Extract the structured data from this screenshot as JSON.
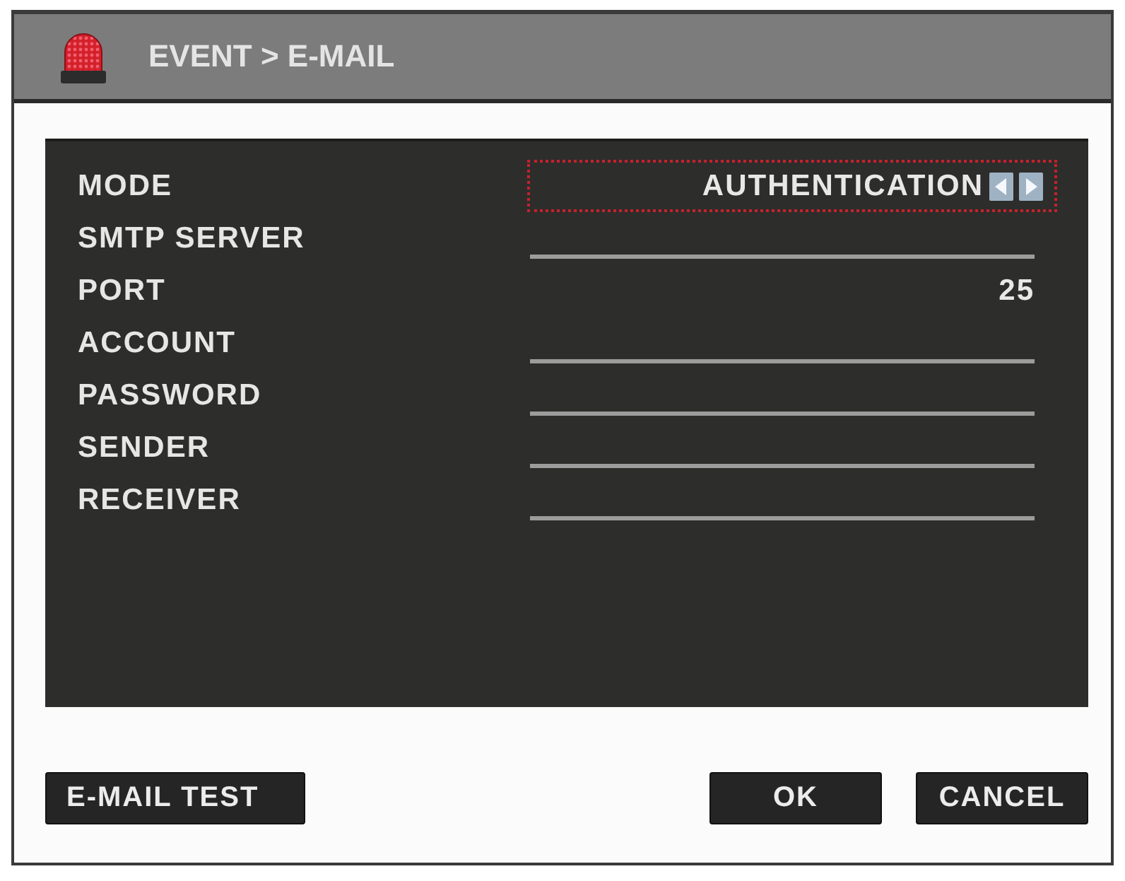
{
  "window": {
    "title": "EVENT > E-MAIL"
  },
  "settings": [
    {
      "kind": "selector",
      "label": "MODE",
      "value": "AUTHENTICATION",
      "focused": true
    },
    {
      "kind": "line",
      "label": "SMTP SERVER",
      "focused": false
    },
    {
      "kind": "plain",
      "label": "PORT",
      "value": "25",
      "focused": false
    },
    {
      "kind": "line",
      "label": "ACCOUNT",
      "focused": false
    },
    {
      "kind": "line",
      "label": "PASSWORD",
      "focused": false
    },
    {
      "kind": "line",
      "label": "SENDER",
      "focused": false
    },
    {
      "kind": "line",
      "label": "RECEIVER",
      "focused": false
    }
  ],
  "footer": {
    "left_buttons": [
      {
        "label": "E-MAIL TEST"
      }
    ],
    "right_buttons": [
      {
        "label": "OK"
      },
      {
        "label": "CANCEL"
      }
    ]
  }
}
